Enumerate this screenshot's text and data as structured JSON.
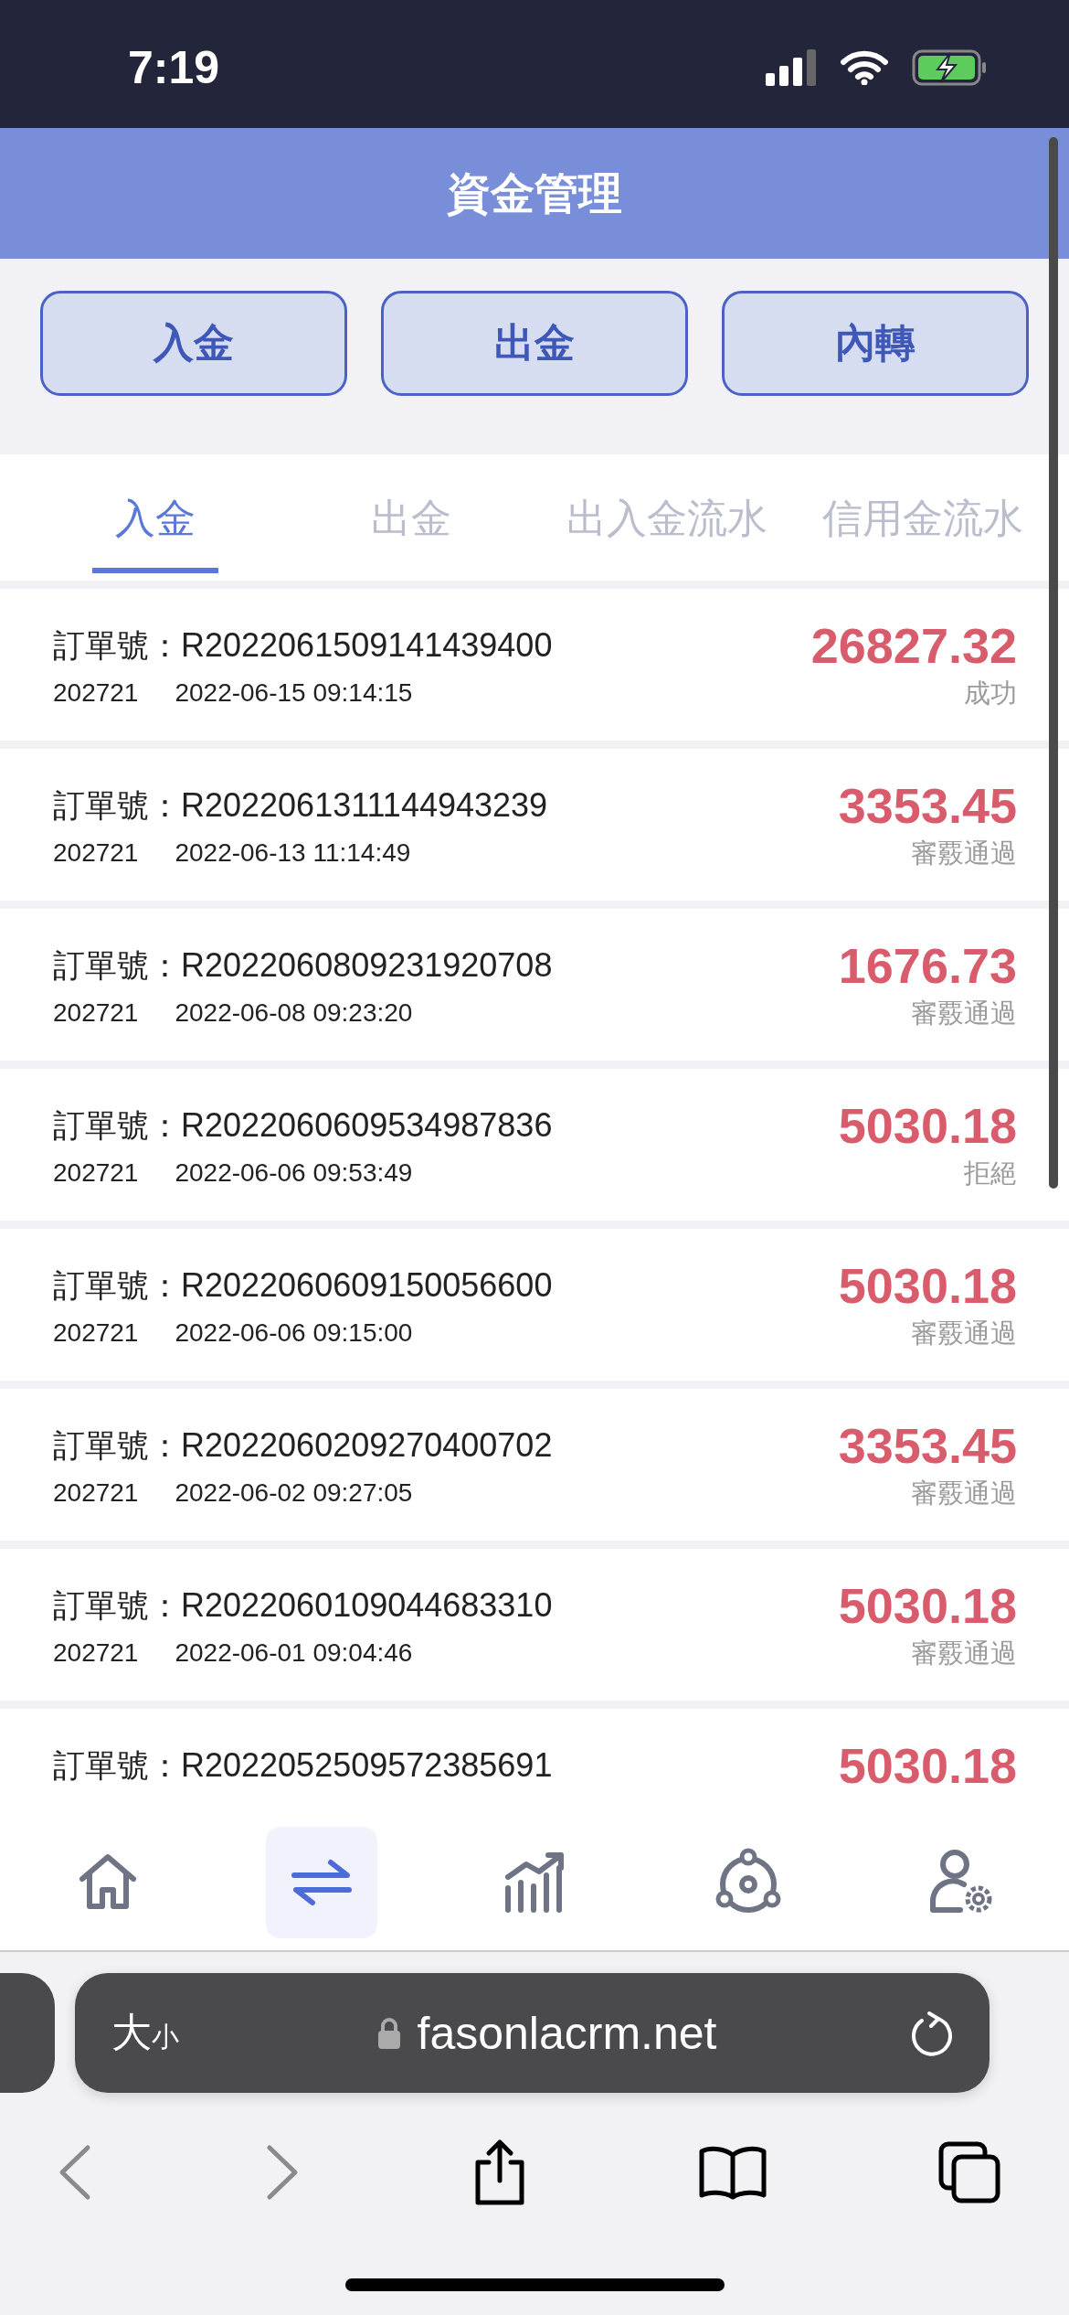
{
  "status_bar": {
    "time": "7:19"
  },
  "header": {
    "title": "資金管理"
  },
  "actions": [
    {
      "label": "入金"
    },
    {
      "label": "出金"
    },
    {
      "label": "內轉"
    }
  ],
  "tabs": [
    {
      "label": "入金",
      "selected": true
    },
    {
      "label": "出金",
      "selected": false
    },
    {
      "label": "出入金流水",
      "selected": false
    },
    {
      "label": "信用金流水",
      "selected": false
    }
  ],
  "records": [
    {
      "label": "訂單號：",
      "order_no": "R2022061509141439400",
      "account": "202721",
      "time": "2022-06-15 09:14:15",
      "amount": "26827.32",
      "status": "成功"
    },
    {
      "label": "訂單號：",
      "order_no": "R2022061311144943239",
      "account": "202721",
      "time": "2022-06-13 11:14:49",
      "amount": "3353.45",
      "status": "審覈通過"
    },
    {
      "label": "訂單號：",
      "order_no": "R2022060809231920708",
      "account": "202721",
      "time": "2022-06-08 09:23:20",
      "amount": "1676.73",
      "status": "審覈通過"
    },
    {
      "label": "訂單號：",
      "order_no": "R2022060609534987836",
      "account": "202721",
      "time": "2022-06-06 09:53:49",
      "amount": "5030.18",
      "status": "拒絕"
    },
    {
      "label": "訂單號：",
      "order_no": "R2022060609150056600",
      "account": "202721",
      "time": "2022-06-06 09:15:00",
      "amount": "5030.18",
      "status": "審覈通過"
    },
    {
      "label": "訂單號：",
      "order_no": "R2022060209270400702",
      "account": "202721",
      "time": "2022-06-02 09:27:05",
      "amount": "3353.45",
      "status": "審覈通過"
    },
    {
      "label": "訂單號：",
      "order_no": "R2022060109044683310",
      "account": "202721",
      "time": "2022-06-01 09:04:46",
      "amount": "5030.18",
      "status": "審覈通過"
    },
    {
      "label": "訂單號：",
      "order_no": "R2022052509572385691",
      "amount": "5030.18"
    }
  ],
  "bottom_nav": [
    {
      "kind": "home",
      "selected": false
    },
    {
      "kind": "transfer",
      "selected": true
    },
    {
      "kind": "chart",
      "selected": false
    },
    {
      "kind": "community",
      "selected": false
    },
    {
      "kind": "user-settings",
      "selected": false
    }
  ],
  "browser": {
    "text_size": "大小",
    "url": "fasonlacrm.net"
  }
}
